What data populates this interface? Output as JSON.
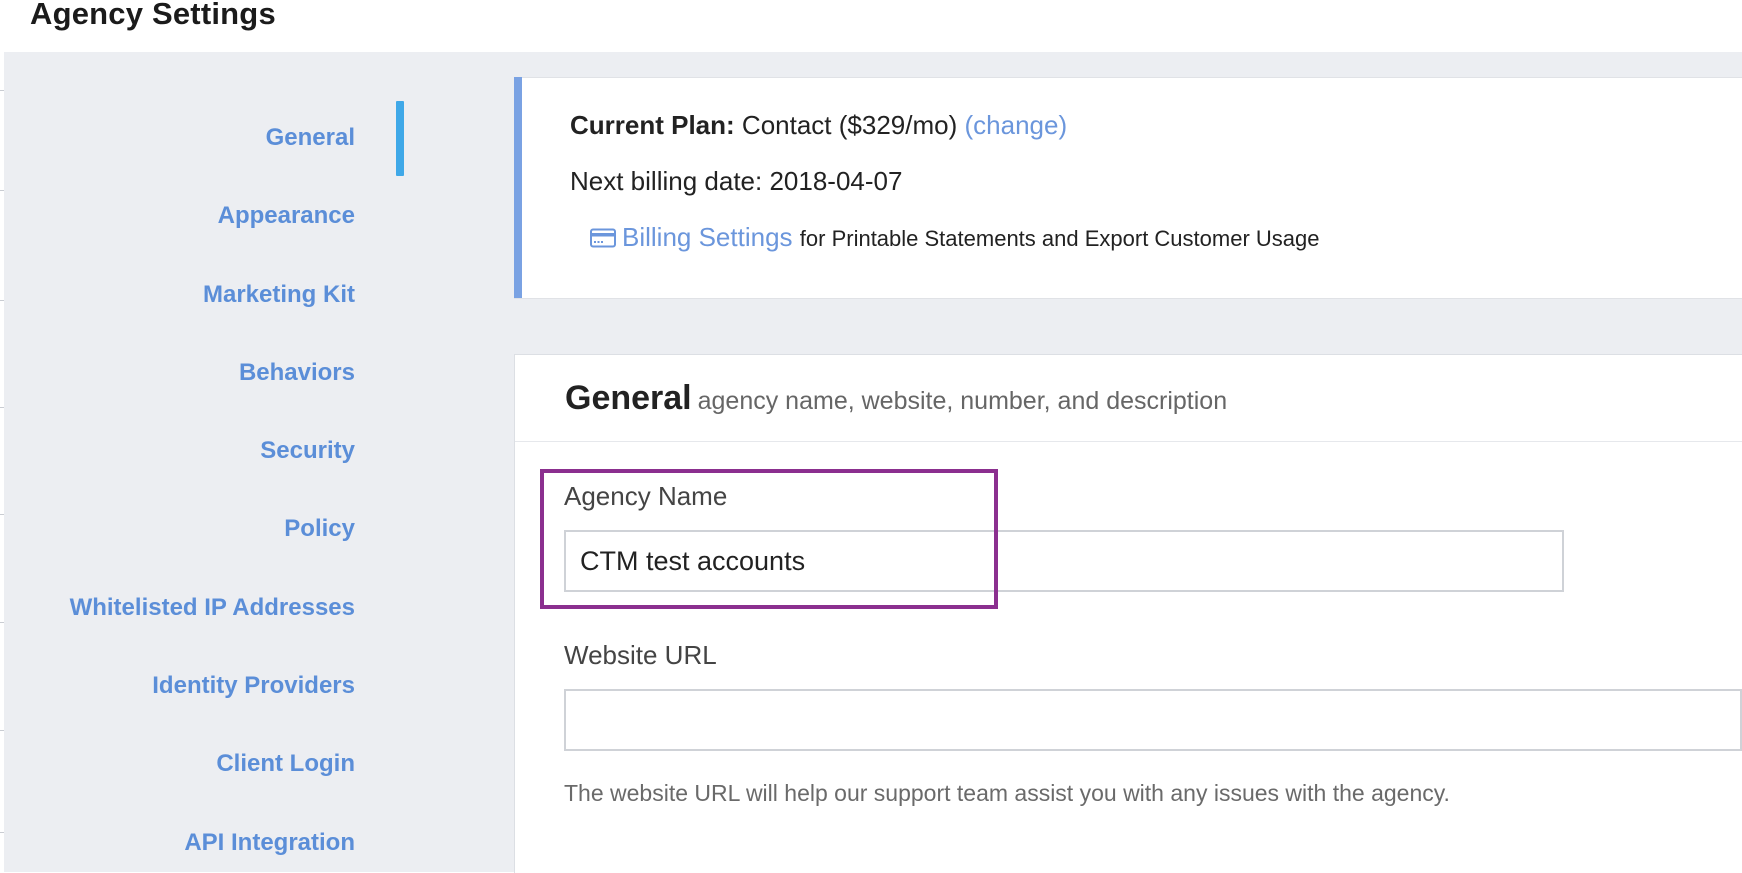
{
  "header": {
    "title": "Agency Settings"
  },
  "sidebar": {
    "active_color": "#3fa8e8",
    "items": [
      {
        "label": "General",
        "active": true
      },
      {
        "label": "Appearance"
      },
      {
        "label": "Marketing Kit"
      },
      {
        "label": "Behaviors"
      },
      {
        "label": "Security"
      },
      {
        "label": "Policy"
      },
      {
        "label": "Whitelisted IP Addresses"
      },
      {
        "label": "Identity Providers"
      },
      {
        "label": "Client Login"
      },
      {
        "label": "API Integration"
      }
    ]
  },
  "plan": {
    "current_label": "Current Plan:",
    "current_value": "Contact ($329/mo)",
    "change_link": "(change)",
    "next_billing": "Next billing date: 2018-04-07",
    "billing_link": "Billing Settings",
    "billing_note": "for Printable Statements and Export Customer Usage",
    "billing_icon": "credit-card-icon"
  },
  "general": {
    "title": "General",
    "subtitle": "agency name, website, number, and description",
    "agency_name_label": "Agency Name",
    "agency_name_value": "CTM test accounts",
    "website_label": "Website URL",
    "website_value": "",
    "website_help": "The website URL will help our support team assist you with any issues with the agency."
  },
  "colors": {
    "link": "#6b96dc",
    "highlight": "#8b2f8f",
    "plan_accent": "#7aa2e3"
  }
}
